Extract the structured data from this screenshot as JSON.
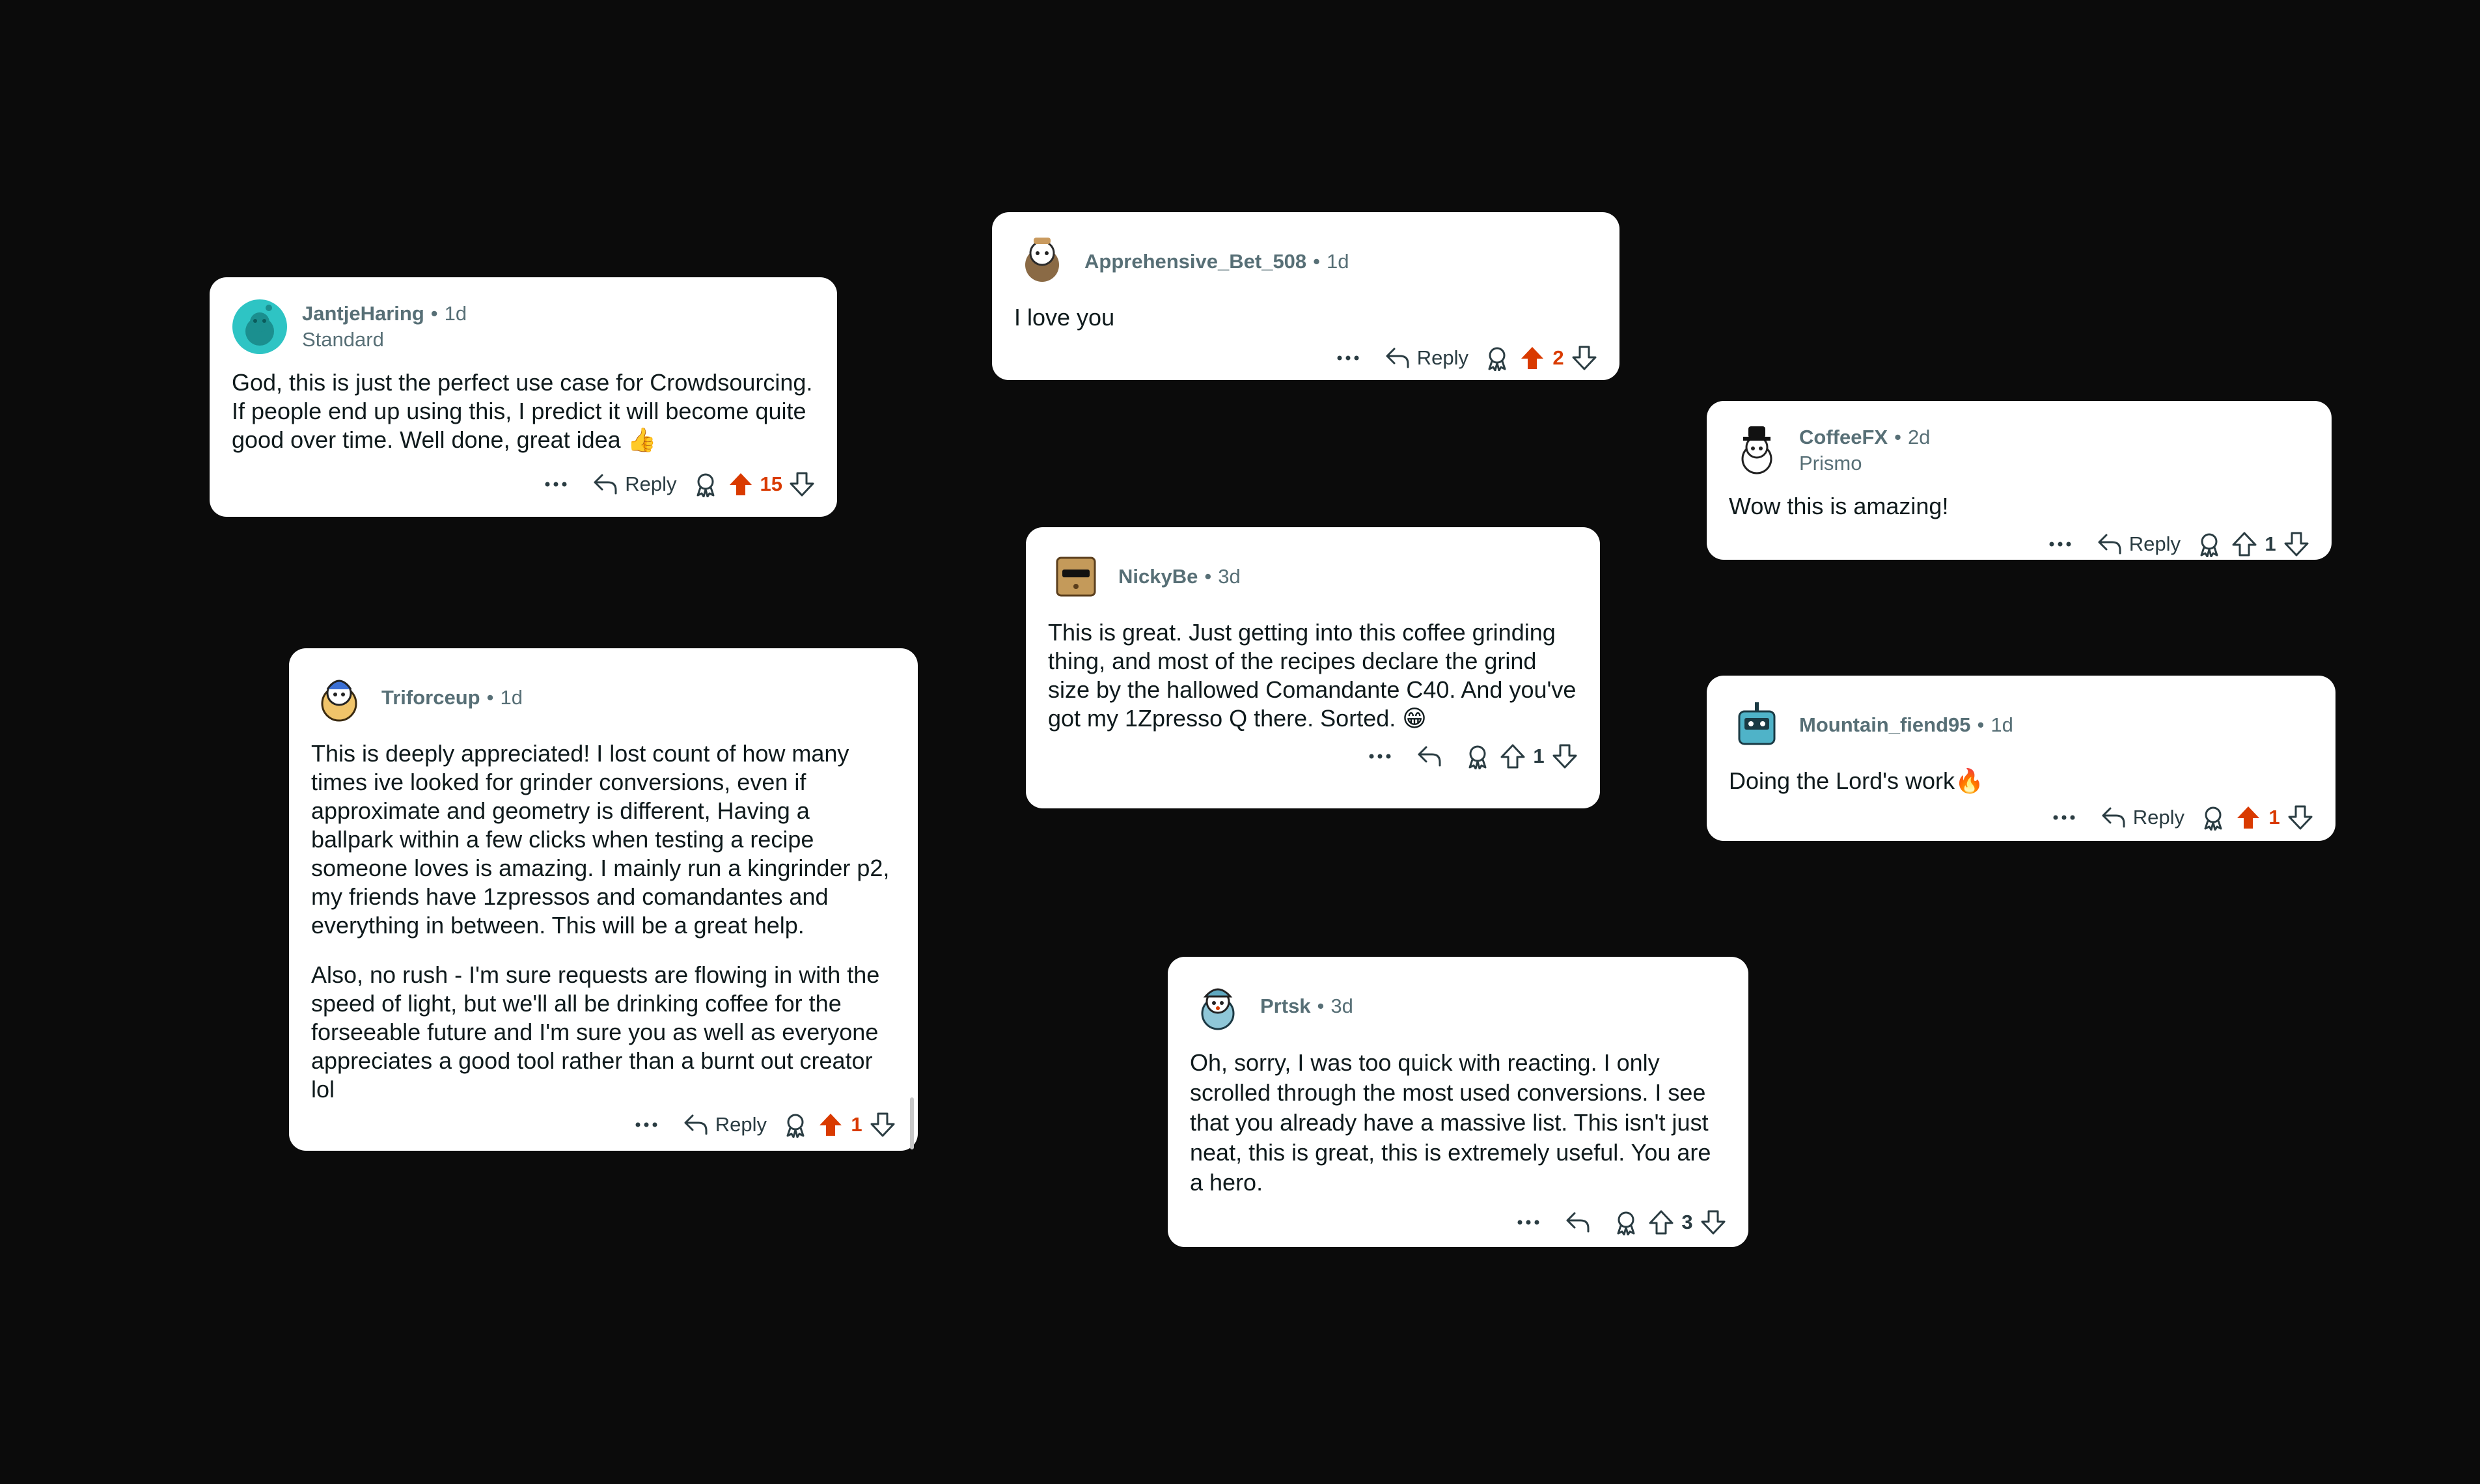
{
  "colors": {
    "background": "#0b0b0b",
    "card": "#ffffff",
    "upvote_active": "#d93a00",
    "meta_text": "#576f76"
  },
  "comments": [
    {
      "username": "JantjeHaring",
      "time": "1d",
      "flair": "Standard",
      "avatar_icon": "snoo-avatar-teal",
      "paragraphs": [
        "God, this is just the perfect use case for Crowdsourcing. If people end up using this, I predict it will become quite good over time. Well done, great idea 👍"
      ],
      "reply_label": "Reply",
      "score": "15",
      "upvoted": true
    },
    {
      "username": "Apprehensive_Bet_508",
      "time": "1d",
      "flair": "",
      "avatar_icon": "snoo-avatar-brown",
      "paragraphs": [
        "I love you"
      ],
      "reply_label": "Reply",
      "score": "2",
      "upvoted": true
    },
    {
      "username": "CoffeeFX",
      "time": "2d",
      "flair": "Prismo",
      "avatar_icon": "snoo-avatar-hat",
      "paragraphs": [
        "Wow this is amazing!"
      ],
      "reply_label": "Reply",
      "score": "1",
      "upvoted": false
    },
    {
      "username": "NickyBe",
      "time": "3d",
      "flair": "",
      "avatar_icon": "snoo-avatar-box",
      "paragraphs": [
        "This is great. Just getting into this coffee grinding thing, and most of the recipes declare the grind size by the hallowed Comandante C40. And you've got my 1Zpresso Q there. Sorted. 😁"
      ],
      "reply_label": "",
      "score": "1",
      "upvoted": false
    },
    {
      "username": "Mountain_fiend95",
      "time": "1d",
      "flair": "",
      "avatar_icon": "snoo-avatar-robot",
      "paragraphs": [
        "Doing the Lord's work🔥"
      ],
      "reply_label": "Reply",
      "score": "1",
      "upvoted": true
    },
    {
      "username": "Triforceup",
      "time": "1d",
      "flair": "",
      "avatar_icon": "snoo-avatar-hoodie",
      "paragraphs": [
        "This is deeply appreciated! I lost count of how many times ive looked for grinder conversions, even if approximate and geometry is different, Having a ballpark within a few clicks when testing a recipe someone loves is amazing. I mainly run a kingrinder p2, my friends have 1zpressos and comandantes and everything in between. This will be a great help.",
        "Also, no rush - I'm sure requests are flowing in with the speed of light, but we'll all be drinking coffee for the forseeable future and I'm sure you as well as everyone appreciates a good tool rather than a burnt out creator lol"
      ],
      "reply_label": "Reply",
      "score": "1",
      "upvoted": true
    },
    {
      "username": "Prtsk",
      "time": "3d",
      "flair": "",
      "avatar_icon": "snoo-avatar-cap",
      "paragraphs": [
        "Oh, sorry, I was too quick with reacting. I only scrolled through the most used conversions. I see that you already have a massive list. This isn't just neat, this is great, this is extremely useful. You are a hero."
      ],
      "reply_label": "",
      "score": "3",
      "upvoted": false
    }
  ]
}
